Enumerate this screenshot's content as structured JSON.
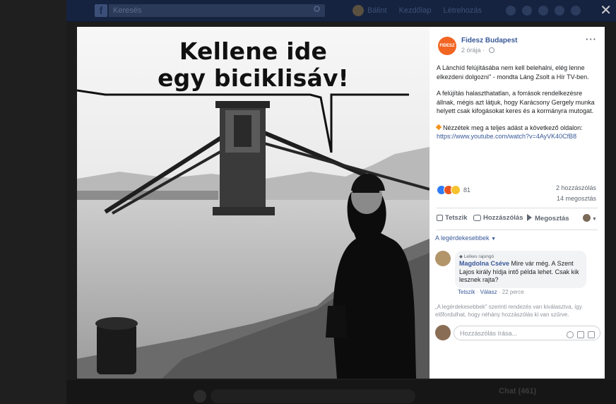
{
  "topbar": {
    "search_placeholder": "Keresés",
    "links": [
      "Bálint",
      "Kezdőlap",
      "Létrehozás"
    ]
  },
  "photo": {
    "headline_line1": "Kellene ide",
    "headline_line2": "egy biciklisáv!"
  },
  "post": {
    "page_name": "Fidesz Budapest",
    "page_badge": "FIDESZ",
    "time": "2 órája",
    "paragraph1": "A Lánchíd felújításába nem kell belehalni, elég lenne elkezdeni dolgozni\" - mondta Láng Zsolt a Hír TV-ben.",
    "paragraph2": "A felújítás halaszthatatlan, a források rendelkezésre állnak, mégis azt látjuk, hogy Karácsony Gergely munka helyett csak kifogásokat keres és a kormányra mutogat.",
    "paragraph3": "Nézzétek meg a teljes adást a következő oldalon:",
    "url": "https://www.youtube.com/watch?v=4AyVK40CfB8",
    "reaction_count": "81",
    "comments_count": "2 hozzászólás",
    "shares_count": "14 megosztás"
  },
  "actions": {
    "like": "Tetszik",
    "comment": "Hozzászólás",
    "share": "Megosztás"
  },
  "comments": {
    "sort_label": "A legérdekesebbek",
    "items": [
      {
        "badge": "Lelkes rajongó",
        "author": "Magdolna Cséve",
        "text": "Mire vár még. A Szent Lajos király hídja intő példa lehet. Csak kik lesznek rajta?",
        "like": "Tetszik",
        "reply": "Válasz",
        "time": "22 perce"
      }
    ],
    "note": "„A legérdekesebbek\" szerinti rendezés van kiválasztva, így előfordulhat, hogy néhány hozzászólás ki van szűrve.",
    "input_placeholder": "Hozzászólás írása..."
  },
  "chat": {
    "label": "Chat (461)"
  },
  "colors": {
    "accent": "#385898",
    "page_brand": "#f26522",
    "topbar": "#152340"
  },
  "icons": [
    "facebook-logo",
    "search-icon",
    "close-icon",
    "globe-icon",
    "more-icon",
    "like-icon",
    "comment-icon",
    "share-icon",
    "emoji-icon",
    "camera-icon",
    "gif-icon"
  ]
}
